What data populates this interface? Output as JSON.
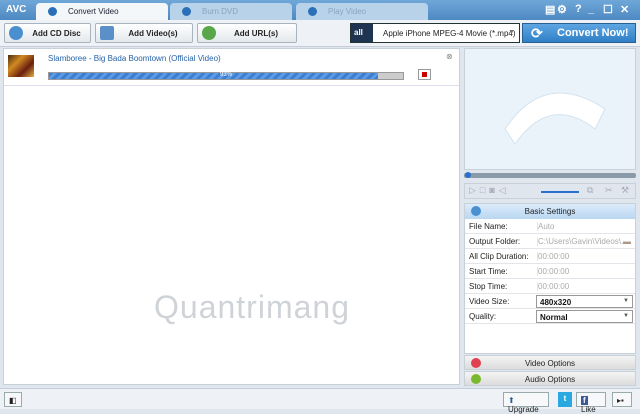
{
  "app": {
    "logo": "AVC",
    "watermark": "Quantrimang"
  },
  "tabs": [
    {
      "label": "Convert Video",
      "active": true
    },
    {
      "label": "Burn DVD"
    },
    {
      "label": "Play Video"
    }
  ],
  "window_buttons": {
    "help": "?",
    "minimize": "_",
    "maximize": "☐",
    "close": "✕"
  },
  "toolbar": {
    "add_cd": "Add CD Disc",
    "add_video": "Add Video(s)",
    "add_url": "Add URL(s)",
    "format": "Apple iPhone MPEG-4 Movie (*.mp4)",
    "format_icon_text": "all",
    "convert": "Convert Now!"
  },
  "list": {
    "items": [
      {
        "title": "Slamboree - Big Bada Boomtown (Official Video)",
        "progress_label": "93%",
        "progress": 93
      }
    ]
  },
  "settings": {
    "header": "Basic Settings",
    "rows": [
      {
        "label": "File Name:",
        "value": "Auto"
      },
      {
        "label": "Output Folder:",
        "value": "C:\\Users\\Gavin\\Videos\\..."
      },
      {
        "label": "All Clip Duration:",
        "value": "00:00:00"
      },
      {
        "label": "Start Time:",
        "value": "00:00:00"
      },
      {
        "label": "Stop Time:",
        "value": "00:00:00"
      },
      {
        "label": "Video Size:",
        "value": "480x320"
      },
      {
        "label": "Quality:",
        "value": "Normal"
      }
    ],
    "video_options": "Video Options",
    "audio_options": "Audio Options"
  },
  "bottom": {
    "upgrade": "Upgrade",
    "twitter": "t",
    "like": "Like",
    "facebook": "f"
  },
  "colors": {
    "accent": "#2f7fc6",
    "titlebar": "#5b97cc"
  }
}
